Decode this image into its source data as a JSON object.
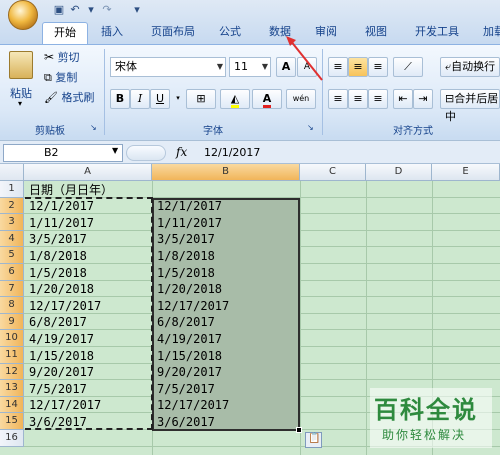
{
  "quick_access": {
    "undo_icon": "↶",
    "redo_icon": "↷",
    "dropdown_icon": "▾"
  },
  "tabs": [
    {
      "label": "开始",
      "active": true
    },
    {
      "label": "插入"
    },
    {
      "label": "页面布局"
    },
    {
      "label": "公式"
    },
    {
      "label": "数据"
    },
    {
      "label": "审阅"
    },
    {
      "label": "视图"
    },
    {
      "label": "开发工具"
    },
    {
      "label": "加载"
    }
  ],
  "clipboard": {
    "paste_label": "粘贴",
    "cut_label": "剪切",
    "copy_label": "复制",
    "format_painter_label": "格式刷",
    "group_label": "剪贴板"
  },
  "font": {
    "font_name": "宋体",
    "font_size": "11",
    "grow_label": "A",
    "shrink_label": "A",
    "bold_label": "B",
    "italic_label": "I",
    "underline_label": "U",
    "font_color_label": "A",
    "phonetic_label": "wén",
    "group_label": "字体"
  },
  "alignment": {
    "wrap_label": "自动换行",
    "merge_label": "合并后居中",
    "group_label": "对齐方式"
  },
  "formula_bar": {
    "name_box": "B2",
    "fx": "fx",
    "value": "12/1/2017"
  },
  "columns": [
    "A",
    "B",
    "C",
    "D",
    "E"
  ],
  "rows": [
    "1",
    "2",
    "3",
    "4",
    "5",
    "6",
    "7",
    "8",
    "9",
    "10",
    "11",
    "12",
    "13",
    "14",
    "15",
    "16"
  ],
  "colA": [
    "日期（月日年）",
    "12/1/2017",
    "1/11/2017",
    "3/5/2017",
    "1/8/2018",
    "1/5/2018",
    "1/20/2018",
    "12/17/2017",
    "6/8/2017",
    "4/19/2017",
    "1/15/2018",
    "9/20/2017",
    "7/5/2017",
    "12/17/2017",
    "3/6/2017"
  ],
  "colB": [
    "12/1/2017",
    "1/11/2017",
    "3/5/2017",
    "1/8/2018",
    "1/5/2018",
    "1/20/2018",
    "12/17/2017",
    "6/8/2017",
    "4/19/2017",
    "1/15/2018",
    "9/20/2017",
    "7/5/2017",
    "12/17/2017",
    "3/6/2017"
  ],
  "watermark": {
    "title": "百科全说",
    "subtitle": "助你轻松解决"
  },
  "colors": {
    "selection_fill": "#a8bca8",
    "grid_bg": "#cde8cf",
    "annotation_arrow": "#e03030"
  }
}
